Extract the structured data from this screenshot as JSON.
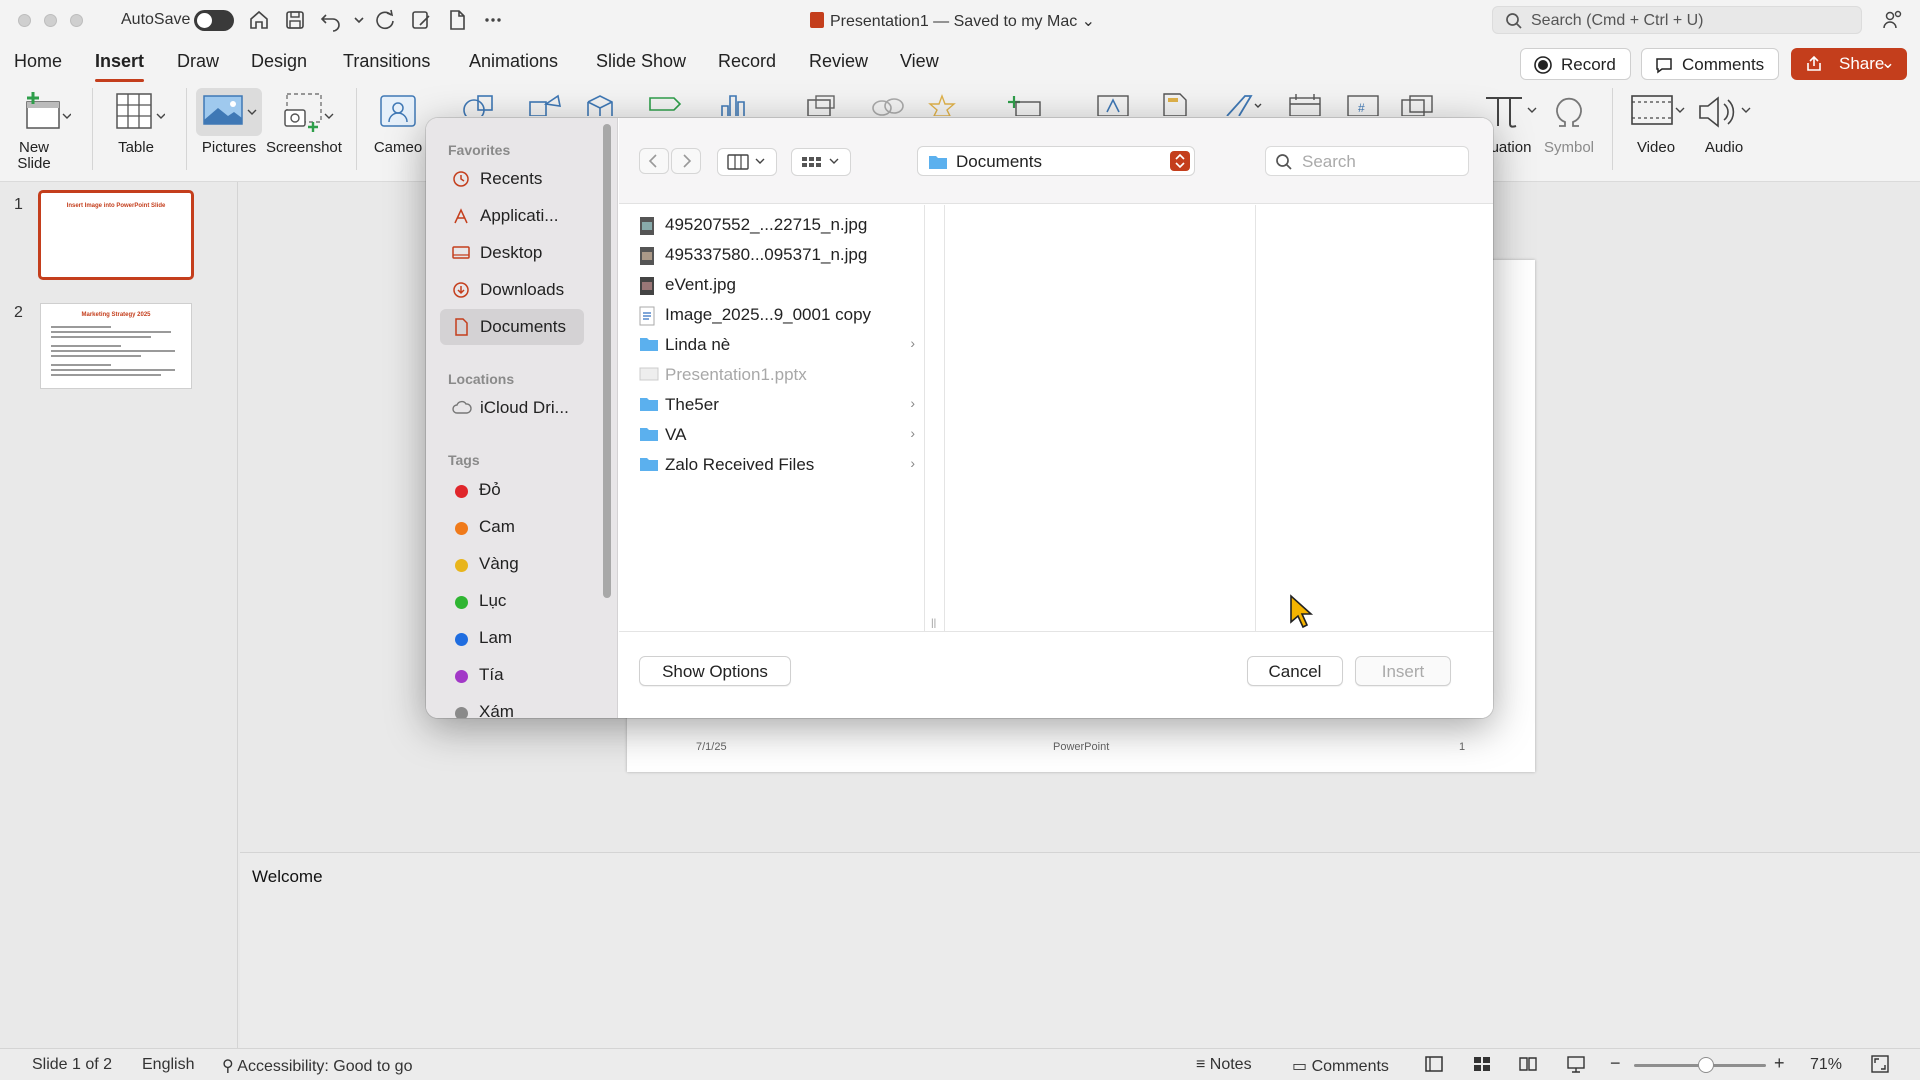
{
  "titlebar": {
    "autosave_label": "AutoSave",
    "window_title": "Presentation1 — Saved to my Mac",
    "search_placeholder": "Search (Cmd + Ctrl + U)"
  },
  "ribbon_tabs": [
    "Home",
    "Insert",
    "Draw",
    "Design",
    "Transitions",
    "Animations",
    "Slide Show",
    "Record",
    "Review",
    "View"
  ],
  "active_tab": "Insert",
  "header_buttons": {
    "record": "Record",
    "comments": "Comments",
    "share": "Share"
  },
  "ribbon": {
    "new_slide": "New Slide",
    "table": "Table",
    "pictures": "Pictures",
    "screenshot": "Screenshot",
    "cameo": "Cameo",
    "equation": "uation",
    "symbol": "Symbol",
    "video": "Video",
    "audio": "Audio"
  },
  "thumbnails": [
    {
      "number": "1",
      "title": "Insert Image into PowerPoint Slide"
    },
    {
      "number": "2",
      "title": "Marketing Strategy 2025"
    }
  ],
  "slide_footer": {
    "date": "7/1/25",
    "center": "PowerPoint",
    "page": "1"
  },
  "notes": {
    "text": "Welcome"
  },
  "dialog": {
    "sidebar": {
      "favorites_header": "Favorites",
      "favorites": [
        "Recents",
        "Applicati...",
        "Desktop",
        "Downloads",
        "Documents"
      ],
      "selected": "Documents",
      "locations_header": "Locations",
      "locations": [
        "iCloud Dri..."
      ],
      "tags_header": "Tags",
      "tags": [
        {
          "name": "Đỏ",
          "color": "#e0262b"
        },
        {
          "name": "Cam",
          "color": "#f07a1a"
        },
        {
          "name": "Vàng",
          "color": "#e8b51c"
        },
        {
          "name": "Lục",
          "color": "#2fb532"
        },
        {
          "name": "Lam",
          "color": "#1f6de0"
        },
        {
          "name": "Tía",
          "color": "#a238c7"
        },
        {
          "name": "Xám",
          "color": "#8a8a8a"
        }
      ]
    },
    "location": "Documents",
    "search_placeholder": "Search",
    "files": [
      {
        "name": "495207552_...22715_n.jpg",
        "kind": "image",
        "dimmed": false,
        "folder": false
      },
      {
        "name": "495337580...095371_n.jpg",
        "kind": "image",
        "dimmed": false,
        "folder": false
      },
      {
        "name": "eVent.jpg",
        "kind": "image",
        "dimmed": false,
        "folder": false
      },
      {
        "name": "Image_2025...9_0001 copy",
        "kind": "doc",
        "dimmed": false,
        "folder": false
      },
      {
        "name": "Linda nè",
        "kind": "folder",
        "dimmed": false,
        "folder": true
      },
      {
        "name": "Presentation1.pptx",
        "kind": "pptx",
        "dimmed": true,
        "folder": false
      },
      {
        "name": "The5er",
        "kind": "folder",
        "dimmed": false,
        "folder": true
      },
      {
        "name": "VA",
        "kind": "folder",
        "dimmed": false,
        "folder": true
      },
      {
        "name": "Zalo Received Files",
        "kind": "folder",
        "dimmed": false,
        "folder": true
      }
    ],
    "show_options": "Show Options",
    "cancel": "Cancel",
    "insert": "Insert"
  },
  "statusbar": {
    "slide_info": "Slide 1 of 2",
    "language": "English",
    "accessibility": "Accessibility: Good to go",
    "notes": "Notes",
    "comments": "Comments",
    "zoom": "71%",
    "zoom_level": 0.55
  },
  "colors": {
    "accent": "#c43e1c",
    "folder_blue": "#5bb0ee"
  }
}
